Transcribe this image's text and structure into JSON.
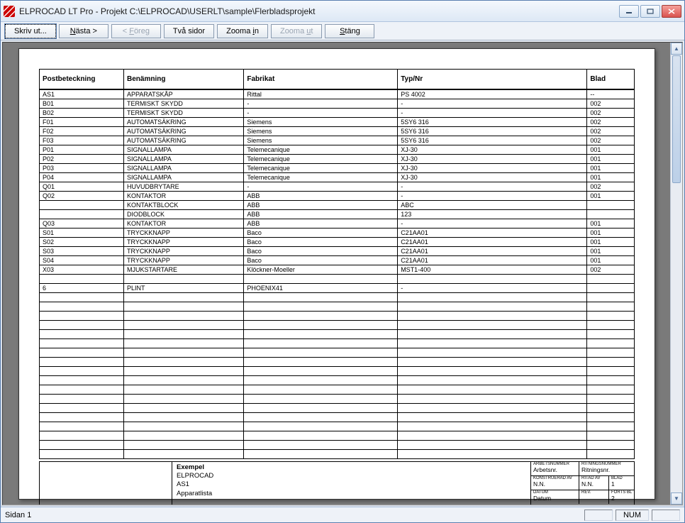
{
  "window": {
    "title": "ELPROCAD LT Pro - Projekt C:\\ELPROCAD\\USERLT\\sample\\Flerbladsprojekt"
  },
  "toolbar": {
    "print": "Skriv ut...",
    "next": "Nästa >",
    "prev": "< Föreg",
    "two_pages": "Två sidor",
    "zoom_in": "Zooma in",
    "zoom_out": "Zooma ut",
    "close": "Stäng"
  },
  "table": {
    "headers": {
      "postbeteckning": "Postbeteckning",
      "benamning": "Benämning",
      "fabrikat": "Fabrikat",
      "typnr": "Typ/Nr",
      "blad": "Blad"
    },
    "rows": [
      {
        "c1": "AS1",
        "c2": "APPARATSKÅP",
        "c3": "Rittal",
        "c4": "PS 4002",
        "c5": "--"
      },
      {
        "c1": "B01",
        "c2": "TERMISKT SKYDD",
        "c3": "-",
        "c4": "-",
        "c5": "002"
      },
      {
        "c1": "B02",
        "c2": "TERMISKT SKYDD",
        "c3": "-",
        "c4": "-",
        "c5": "002"
      },
      {
        "c1": "F01",
        "c2": "AUTOMATSÄKRING",
        "c3": "Siemens",
        "c4": "5SY6 316",
        "c5": "002"
      },
      {
        "c1": "F02",
        "c2": "AUTOMATSÄKRING",
        "c3": "Siemens",
        "c4": "5SY6 316",
        "c5": "002"
      },
      {
        "c1": "F03",
        "c2": "AUTOMATSÄKRING",
        "c3": "Siemens",
        "c4": "5SY6 316",
        "c5": "002"
      },
      {
        "c1": "P01",
        "c2": "SIGNALLAMPA",
        "c3": "Telemecanique",
        "c4": "XJ-30",
        "c5": "001"
      },
      {
        "c1": "P02",
        "c2": "SIGNALLAMPA",
        "c3": "Telemecanique",
        "c4": "XJ-30",
        "c5": "001"
      },
      {
        "c1": "P03",
        "c2": "SIGNALLAMPA",
        "c3": "Telemecanique",
        "c4": "XJ-30",
        "c5": "001"
      },
      {
        "c1": "P04",
        "c2": "SIGNALLAMPA",
        "c3": "Telemecanique",
        "c4": "XJ-30",
        "c5": "001"
      },
      {
        "c1": "Q01",
        "c2": "HUVUDBRYTARE",
        "c3": "-",
        "c4": "-",
        "c5": "002"
      },
      {
        "c1": "Q02",
        "c2": "KONTAKTOR",
        "c3": "ABB",
        "c4": "-",
        "c5": "001"
      },
      {
        "c1": "",
        "c2": "KONTAKTBLOCK",
        "c3": "ABB",
        "c4": "ABC",
        "c5": ""
      },
      {
        "c1": "",
        "c2": "DIODBLOCK",
        "c3": "ABB",
        "c4": "123",
        "c5": ""
      },
      {
        "c1": "Q03",
        "c2": "KONTAKTOR",
        "c3": "ABB",
        "c4": "-",
        "c5": "001"
      },
      {
        "c1": "S01",
        "c2": "TRYCKKNAPP",
        "c3": "Baco",
        "c4": "C21AA01",
        "c5": "001"
      },
      {
        "c1": "S02",
        "c2": "TRYCKKNAPP",
        "c3": "Baco",
        "c4": "C21AA01",
        "c5": "001"
      },
      {
        "c1": "S03",
        "c2": "TRYCKKNAPP",
        "c3": "Baco",
        "c4": "C21AA01",
        "c5": "001"
      },
      {
        "c1": "S04",
        "c2": "TRYCKKNAPP",
        "c3": "Baco",
        "c4": "C21AA01",
        "c5": "001"
      },
      {
        "c1": "X03",
        "c2": "MJUKSTARTARE",
        "c3": "Klöckner-Moeller",
        "c4": "MST1-400",
        "c5": "002"
      },
      {
        "c1": "",
        "c2": "",
        "c3": "",
        "c4": "",
        "c5": ""
      },
      {
        "c1": "6",
        "c2": "PLINT",
        "c3": "PHOENIX41",
        "c4": "-",
        "c5": ""
      },
      {
        "c1": "",
        "c2": "",
        "c3": "",
        "c4": "",
        "c5": ""
      },
      {
        "c1": "",
        "c2": "",
        "c3": "",
        "c4": "",
        "c5": ""
      },
      {
        "c1": "",
        "c2": "",
        "c3": "",
        "c4": "",
        "c5": ""
      },
      {
        "c1": "",
        "c2": "",
        "c3": "",
        "c4": "",
        "c5": ""
      },
      {
        "c1": "",
        "c2": "",
        "c3": "",
        "c4": "",
        "c5": ""
      },
      {
        "c1": "",
        "c2": "",
        "c3": "",
        "c4": "",
        "c5": ""
      },
      {
        "c1": "",
        "c2": "",
        "c3": "",
        "c4": "",
        "c5": ""
      },
      {
        "c1": "",
        "c2": "",
        "c3": "",
        "c4": "",
        "c5": ""
      },
      {
        "c1": "",
        "c2": "",
        "c3": "",
        "c4": "",
        "c5": ""
      },
      {
        "c1": "",
        "c2": "",
        "c3": "",
        "c4": "",
        "c5": ""
      },
      {
        "c1": "",
        "c2": "",
        "c3": "",
        "c4": "",
        "c5": ""
      },
      {
        "c1": "",
        "c2": "",
        "c3": "",
        "c4": "",
        "c5": ""
      },
      {
        "c1": "",
        "c2": "",
        "c3": "",
        "c4": "",
        "c5": ""
      },
      {
        "c1": "",
        "c2": "",
        "c3": "",
        "c4": "",
        "c5": ""
      },
      {
        "c1": "",
        "c2": "",
        "c3": "",
        "c4": "",
        "c5": ""
      },
      {
        "c1": "",
        "c2": "",
        "c3": "",
        "c4": "",
        "c5": ""
      },
      {
        "c1": "",
        "c2": "",
        "c3": "",
        "c4": "",
        "c5": ""
      },
      {
        "c1": "",
        "c2": "",
        "c3": "",
        "c4": "",
        "c5": ""
      }
    ]
  },
  "titleblock": {
    "exempel": "Exempel",
    "elprocad": "ELPROCAD",
    "as1": "AS1",
    "apparatlista": "Apparatlista",
    "arbetsnummer_lbl": "ARBETSNUMMER",
    "arbetsnr": "Arbetsnr.",
    "ritningsnummer_lbl": "RITNINGSNUMMER",
    "ritningsnr": "Ritningsnr.",
    "konstruerad_lbl": "KONSTRUERAD AV",
    "nn1": "N.N.",
    "ritad_lbl": "RITAD AV",
    "nn2": "N.N.",
    "blad_lbl": "BLAD",
    "blad_val": "1",
    "datum_lbl": "DATUM",
    "datum": "Datum",
    "rev_lbl": "REV.",
    "forts_lbl": "FORTS BL",
    "forts_val": "2"
  },
  "statusbar": {
    "page": "Sidan 1",
    "num": "NUM"
  }
}
